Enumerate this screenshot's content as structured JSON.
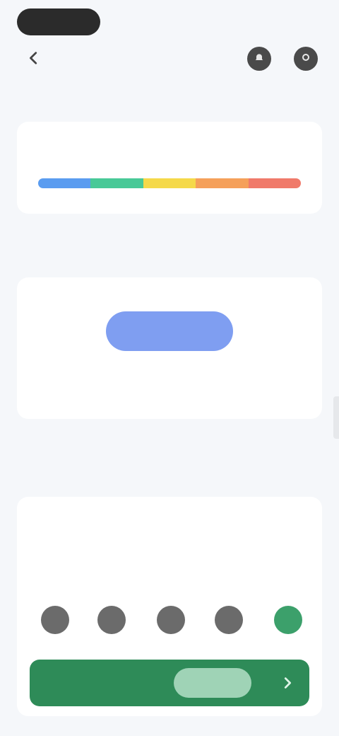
{
  "header": {
    "app_title": "",
    "top_right": "",
    "sub_right": ""
  },
  "levels": {
    "title": "",
    "value": "",
    "label": "",
    "scale_colors": [
      "#5a9cf0",
      "#48c997",
      "#f5d94a",
      "#f5a05a",
      "#f07a6a"
    ]
  },
  "schedule": {
    "title": "",
    "link": "",
    "primary_button": "",
    "side_text": "",
    "note": ""
  },
  "session": {
    "title": "",
    "link": "",
    "caption": "",
    "value": "",
    "unit": "",
    "description": "",
    "start_label": "",
    "start_chip": "",
    "icons": [
      "mode-icon",
      "mode-icon",
      "mode-icon",
      "mode-icon",
      "leaf-icon"
    ]
  },
  "colors": {
    "accent_blue": "#7f9ef1",
    "accent_green": "#2e8b58"
  }
}
